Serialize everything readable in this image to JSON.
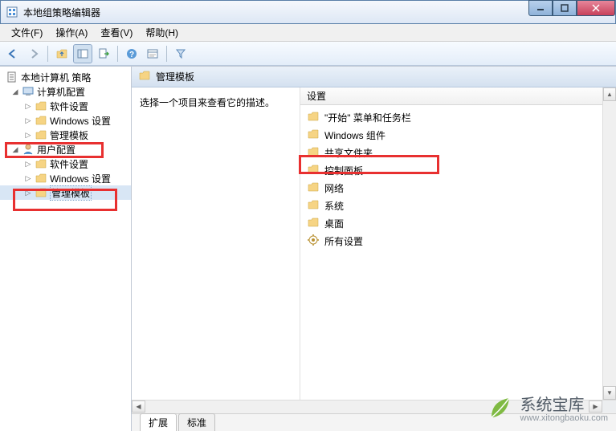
{
  "window": {
    "title": "本地组策略编辑器"
  },
  "menu": {
    "file": "文件(F)",
    "action": "操作(A)",
    "view": "查看(V)",
    "help": "帮助(H)"
  },
  "tree": {
    "root": "本地计算机 策略",
    "computer_config": "计算机配置",
    "cc_software": "软件设置",
    "cc_windows": "Windows 设置",
    "cc_admin": "管理模板",
    "user_config": "用户配置",
    "uc_software": "软件设置",
    "uc_windows": "Windows 设置",
    "uc_admin": "管理模板"
  },
  "content": {
    "header": "管理模板",
    "prompt": "选择一个项目来查看它的描述。",
    "column": "设置",
    "items": [
      "\"开始\" 菜单和任务栏",
      "Windows 组件",
      "共享文件夹",
      "控制面板",
      "网络",
      "系统",
      "桌面",
      "所有设置"
    ],
    "tabs": {
      "extended": "扩展",
      "standard": "标准"
    }
  },
  "watermark": {
    "name": "系统宝库",
    "url": "www.xitongbaoku.com"
  }
}
